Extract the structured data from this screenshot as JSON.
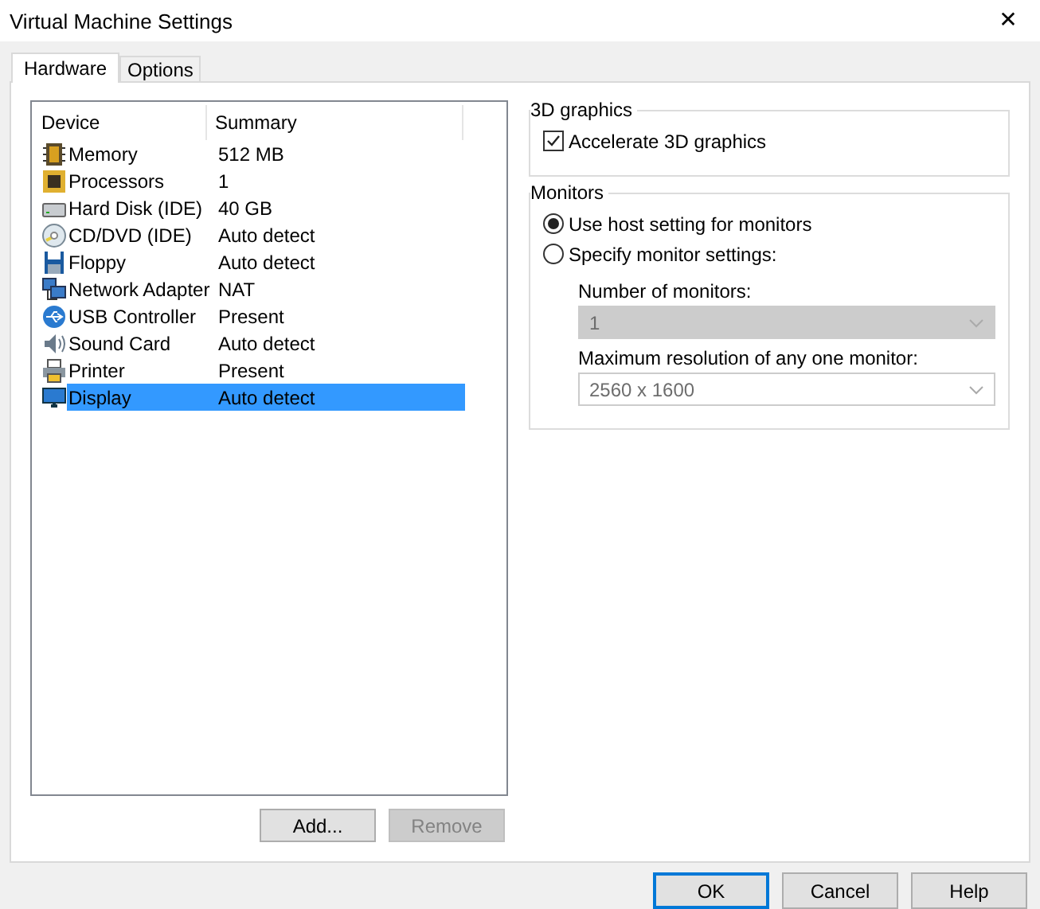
{
  "window": {
    "title": "Virtual Machine Settings",
    "close": "✕"
  },
  "tabs": [
    {
      "label": "Hardware",
      "selected": true
    },
    {
      "label": "Options",
      "selected": false
    }
  ],
  "devices": {
    "columns": [
      "Device",
      "Summary"
    ],
    "rows": [
      {
        "kind": "memory",
        "device": "Memory",
        "summary": "512 MB",
        "selected": false
      },
      {
        "kind": "processor",
        "device": "Processors",
        "summary": "1",
        "selected": false
      },
      {
        "kind": "disk",
        "device": "Hard Disk (IDE)",
        "summary": "40 GB",
        "selected": false
      },
      {
        "kind": "cd",
        "device": "CD/DVD (IDE)",
        "summary": "Auto detect",
        "selected": false
      },
      {
        "kind": "floppy",
        "device": "Floppy",
        "summary": "Auto detect",
        "selected": false
      },
      {
        "kind": "network",
        "device": "Network Adapter",
        "summary": "NAT",
        "selected": false
      },
      {
        "kind": "usb",
        "device": "USB Controller",
        "summary": "Present",
        "selected": false
      },
      {
        "kind": "sound",
        "device": "Sound Card",
        "summary": "Auto detect",
        "selected": false
      },
      {
        "kind": "printer",
        "device": "Printer",
        "summary": "Present",
        "selected": false
      },
      {
        "kind": "display",
        "device": "Display",
        "summary": "Auto detect",
        "selected": true
      }
    ]
  },
  "list_buttons": [
    {
      "label": "Add...",
      "disabled": false
    },
    {
      "label": "Remove",
      "disabled": true
    }
  ],
  "graphics": {
    "title": "3D graphics",
    "checkbox": {
      "label": "Accelerate 3D graphics",
      "checked": true
    }
  },
  "monitors": {
    "title": "Monitors",
    "options": [
      {
        "label": "Use host setting for monitors",
        "selected": true
      },
      {
        "label": "Specify monitor settings:",
        "selected": false
      }
    ],
    "fields": [
      {
        "label": "Number of monitors:",
        "value": "1",
        "disabled": true
      },
      {
        "label": "Maximum resolution of any one monitor:",
        "value": "2560 x 1600",
        "disabled": true
      }
    ]
  },
  "dialog_buttons": [
    {
      "label": "OK",
      "default": true
    },
    {
      "label": "Cancel",
      "default": false
    },
    {
      "label": "Help",
      "default": false
    }
  ]
}
